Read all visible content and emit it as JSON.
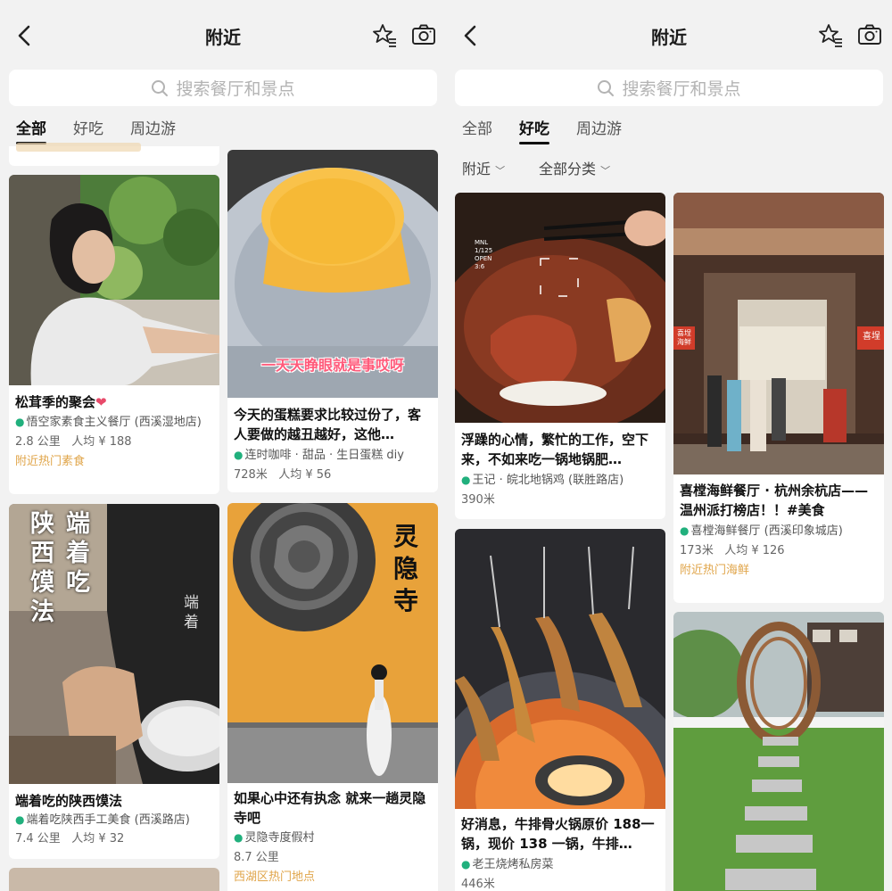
{
  "left": {
    "header": {
      "title": "附近"
    },
    "search": {
      "placeholder": "搜索餐厅和景点"
    },
    "tabs": [
      {
        "label": "全部",
        "active": true
      },
      {
        "label": "好吃"
      },
      {
        "label": "周边游"
      }
    ],
    "cards": [
      {
        "title": "松茸季的聚会",
        "title_emoji": "❤",
        "place": "悟空家素食主义餐厅 (西溪湿地店)",
        "distance": "2.8 公里",
        "avg": "人均 ¥ 188",
        "tag": "附近热门素食"
      },
      {
        "overlay": "一天天睁眼就是事哎呀",
        "title": "今天的蛋糕要求比较过份了，客人要做的越丑越好，这他…",
        "place": "连时咖啡 · 甜品 · 生日蛋糕 diy",
        "distance": "728米",
        "avg": "人均 ¥ 56"
      },
      {
        "overlay_col1": "陕西馍法",
        "overlay_col2": "端着吃",
        "shop_sign": "端着",
        "title": "端着吃的陕西馍法",
        "place": "端着吃陕西手工美食 (西溪路店)",
        "distance": "7.4 公里",
        "avg": "人均 ¥ 32"
      },
      {
        "overlay": "灵隐寺",
        "title": "如果心中还有执念 就来一趟灵隐寺吧",
        "place": "灵隐寺度假村",
        "distance": "8.7 公里",
        "tag": "西湖区热门地点"
      }
    ]
  },
  "right": {
    "header": {
      "title": "附近"
    },
    "search": {
      "placeholder": "搜索餐厅和景点"
    },
    "tabs": [
      {
        "label": "全部"
      },
      {
        "label": "好吃",
        "active": true
      },
      {
        "label": "周边游"
      }
    ],
    "filters": [
      "附近",
      "全部分类"
    ],
    "cards": [
      {
        "camera_overlay": [
          "MNL",
          "1/125",
          "OPEN",
          "3:6"
        ],
        "title": "浮躁的心情，繁忙的工作，空下来，不如来吃一锅地锅肥…",
        "place": "王记 · 皖北地锅鸡 (联胜路店)",
        "distance": "390米"
      },
      {
        "signs": [
          "喜埕海鲜",
          "喜埕"
        ],
        "title": "喜樘海鲜餐厅 · 杭州余杭店——温州派打榜店！！#美食",
        "place": "喜樘海鲜餐厅 (西溪印象城店)",
        "distance": "173米",
        "avg": "人均 ¥ 126",
        "tag": "附近热门海鲜"
      },
      {
        "title": "好消息，牛排骨火锅原价 188一锅，现价 138 一锅，牛排…",
        "place": "老王烧烤私房菜",
        "distance": "446米"
      },
      {}
    ]
  },
  "colors": {
    "accent_green": "#21b07d",
    "tag_orange": "#e0a54a",
    "background": "#f2f2f2"
  },
  "icons": {
    "back": "chevron-left-icon",
    "star": "star-list-icon",
    "camera": "camera-icon",
    "search": "search-icon",
    "pin": "location-pin-icon"
  }
}
